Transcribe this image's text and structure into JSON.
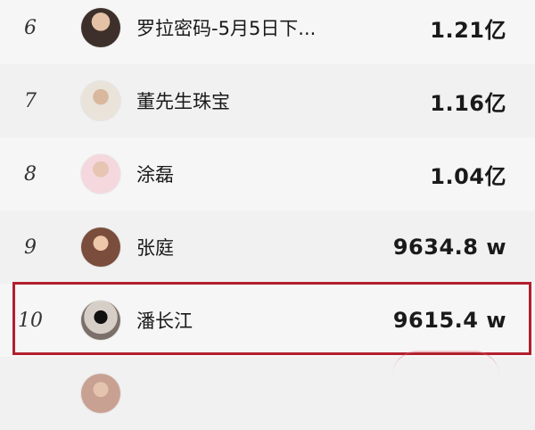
{
  "ranking": {
    "rows": [
      {
        "rank": "6",
        "name": "罗拉密码-5月5日下...",
        "value": "1.21亿",
        "avatar": "avatar-luola"
      },
      {
        "rank": "7",
        "name": "董先生珠宝",
        "value": "1.16亿",
        "avatar": "avatar-dong"
      },
      {
        "rank": "8",
        "name": "涂磊",
        "value": "1.04亿",
        "avatar": "avatar-tulei"
      },
      {
        "rank": "9",
        "name": "张庭",
        "value": "9634.8 w",
        "avatar": "avatar-zhangting"
      },
      {
        "rank": "10",
        "name": "潘长江",
        "value": "9615.4 w",
        "avatar": "avatar-panchangjiang"
      },
      {
        "rank": "",
        "name": "",
        "value": "",
        "avatar": "avatar-partial"
      }
    ]
  },
  "colors": {
    "highlight_border": "#b21f2d"
  }
}
